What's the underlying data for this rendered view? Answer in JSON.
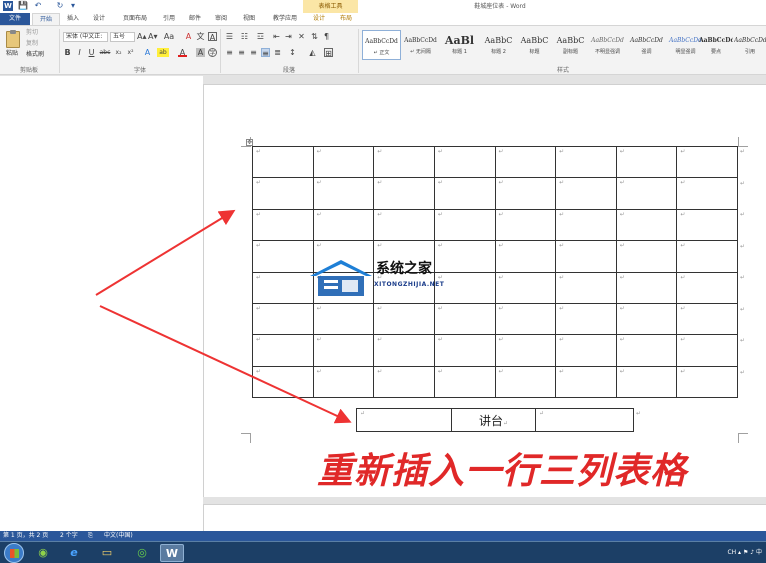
{
  "window": {
    "title": "鞋城座位表 - Word",
    "context_tab_group": "表格工具",
    "quick_access": {
      "save": "💾",
      "undo": "↶",
      "redo": "↻",
      "customize": "▾"
    }
  },
  "tabs": [
    {
      "id": "file",
      "label": "文件"
    },
    {
      "id": "home",
      "label": "开始"
    },
    {
      "id": "insert",
      "label": "插入"
    },
    {
      "id": "design",
      "label": "设计"
    },
    {
      "id": "layout",
      "label": "页面布局"
    },
    {
      "id": "references",
      "label": "引用"
    },
    {
      "id": "mailings",
      "label": "邮件"
    },
    {
      "id": "review",
      "label": "审阅"
    },
    {
      "id": "view",
      "label": "视图"
    },
    {
      "id": "edu",
      "label": "教学应用"
    },
    {
      "id": "table-design",
      "label": "设计"
    },
    {
      "id": "table-layout",
      "label": "布局"
    }
  ],
  "ribbon": {
    "clipboard": {
      "paste": "粘贴",
      "cut": "剪切",
      "copy": "复制",
      "format_painter": "格式刷",
      "label": "剪贴板"
    },
    "font": {
      "font_name": "宋体 (中文正:",
      "font_size": "五号",
      "label": "字体",
      "bold": "B",
      "italic": "I",
      "underline": "U",
      "strike": "abc",
      "subscript": "x₂",
      "superscript": "x²",
      "grow": "A▴",
      "shrink": "A▾",
      "case": "Aa",
      "clear": "A",
      "phonetic": "文",
      "border": "A",
      "effects": "A",
      "highlight": "ab",
      "color": "A",
      "shade": "A",
      "circle": "字"
    },
    "paragraph": {
      "label": "段落"
    },
    "styles": {
      "label": "样式",
      "items": [
        {
          "sample": "AaBbCcDd",
          "name": "↵ 正文"
        },
        {
          "sample": "AaBbCcDd",
          "name": "↵ 无间隔"
        },
        {
          "sample": "AaBl",
          "name": "标题 1"
        },
        {
          "sample": "AaBbC",
          "name": "标题 2"
        },
        {
          "sample": "AaBbC",
          "name": "标题"
        },
        {
          "sample": "AaBbC",
          "name": "副标题"
        },
        {
          "sample": "AaBbCcDd",
          "name": "不明显强调"
        },
        {
          "sample": "AaBbCcDd",
          "name": "强调"
        },
        {
          "sample": "AaBbCcDd",
          "name": "明显强调"
        },
        {
          "sample": "AaBbCcDd",
          "name": "要点"
        },
        {
          "sample": "AaBbCcDd",
          "name": "引用"
        }
      ]
    }
  },
  "document": {
    "cell_mark": "↵",
    "table_move_handle": "✥",
    "grid": {
      "rows": 8,
      "cols": 8
    },
    "podium": {
      "cells": [
        "",
        "讲台",
        ""
      ]
    }
  },
  "annotation": {
    "text": "重新插入一行三列表格",
    "color": "#e02828"
  },
  "watermark": {
    "cn": "系统之家",
    "en": "XITONGZHIJIA.NET"
  },
  "status": {
    "page": "第 1 页，共 2 页",
    "words": "2 个字",
    "lang": "中文(中国)",
    "proofing": "⎘"
  },
  "taskbar": {
    "items": [
      {
        "name": "browser-360",
        "glyph": "◉"
      },
      {
        "name": "internet-explorer",
        "glyph": "e"
      },
      {
        "name": "file-explorer",
        "glyph": "▭"
      },
      {
        "name": "media-player",
        "glyph": "◎"
      },
      {
        "name": "word",
        "glyph": "W"
      }
    ],
    "tray": "CH ▴ ⚑ ♪ 中"
  }
}
